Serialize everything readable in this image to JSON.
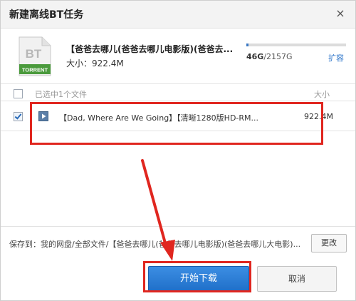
{
  "dialog": {
    "title": "新建离线BT任务",
    "close_glyph": "×"
  },
  "torrent": {
    "icon_text_top": "BT",
    "icon_text_bottom": "TORRENT",
    "name": "【爸爸去哪儿(爸爸去哪儿电影版)(爸爸去...",
    "size_label": "大小：922.4M"
  },
  "quota": {
    "used_fraction": 0.021,
    "used": "46G",
    "total": "/2157G",
    "expand_label": "扩容"
  },
  "file_list": {
    "select_summary": "已选中1个文件",
    "size_header": "大小",
    "rows": [
      {
        "checked": true,
        "icon": "video-file-icon",
        "name": "【Dad, Where Are We Going】【清晰1280版HD-RM...",
        "size": "922.4M"
      }
    ]
  },
  "save": {
    "path_label": "保存到：我的网盘/全部文件/【爸爸去哪儿(爸爸去哪儿电影版)(爸爸去哪儿大电影)...",
    "change_label": "更改"
  },
  "actions": {
    "start_label": "开始下载",
    "cancel_label": "取消"
  },
  "colors": {
    "accent_blue": "#1f6fc9",
    "highlight_red": "#e0261f",
    "torrent_green": "#4a9a3c"
  }
}
